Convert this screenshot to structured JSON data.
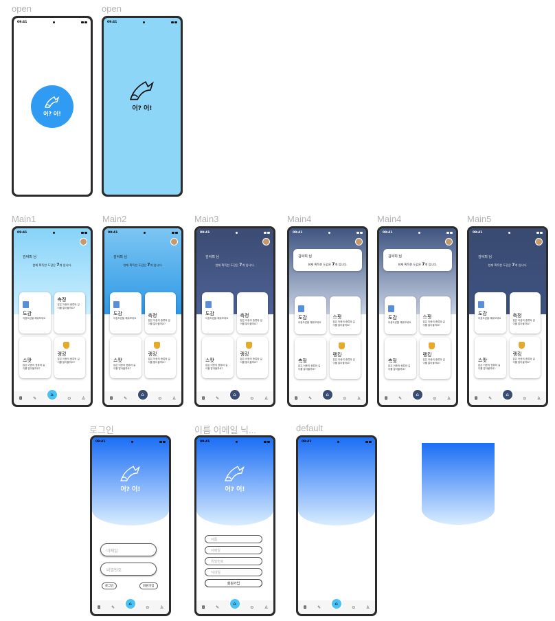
{
  "labels": {
    "open1": "open",
    "open2": "open",
    "main1": "Main1",
    "main2": "Main2",
    "main3": "Main3",
    "main4a": "Main4",
    "main4b": "Main4",
    "main5": "Main5",
    "login": "로그인",
    "signup": "이름 이메일 닉...",
    "default": "default"
  },
  "status": {
    "time": "09:41"
  },
  "brand": {
    "logo_text": "어? 어!"
  },
  "main": {
    "greeting": "김싸피 님",
    "count_prefix": "현재 획득한 도감은 ",
    "count_value": "7",
    "count_suffix": "개 입니다.",
    "tiles": {
      "dogam_title": "도감",
      "dogam_desc": "어종도감을 채워보세요",
      "measure_title": "측정",
      "measure_desc": "잡은 어종의 종류와 길이를 알아볼까요?",
      "spot_title": "스팟",
      "spot_desc": "잡은 어종의 종류와 길이를 알아볼까요?",
      "ranking_title": "랭킹",
      "ranking_desc": "잡은 어종의 종류와 길이를 알아볼까요?"
    }
  },
  "login": {
    "email_placeholder": "이메일",
    "password_placeholder": "비밀번호",
    "login_button": "로그인",
    "signup_button": "회원가입"
  },
  "signup": {
    "name_placeholder": "이름",
    "email_placeholder": "이메일",
    "password_placeholder": "비밀번호",
    "nickname_placeholder": "닉네임",
    "submit_button": "회원가입"
  },
  "colors": {
    "brand_blue": "#2f9bf2",
    "sky": "#8dd6f8",
    "navy": "#3a4c72",
    "gradient_top": "#1b6ef5"
  },
  "icons": {
    "nav": [
      "camera-icon",
      "edit-icon",
      "home-icon",
      "map-pin-icon",
      "user-icon"
    ],
    "logo": "fish-hook-icon"
  }
}
